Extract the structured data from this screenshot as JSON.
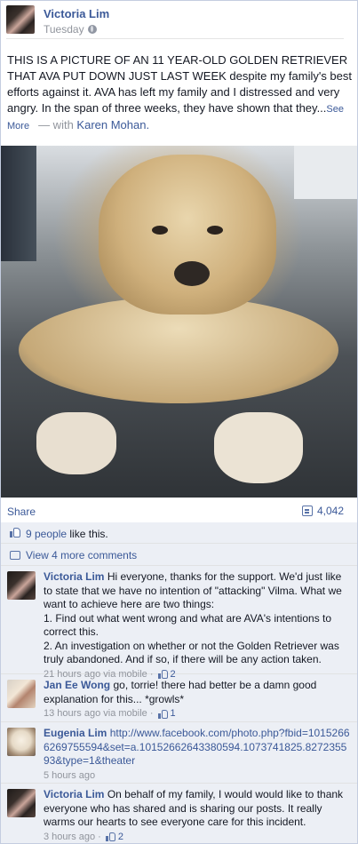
{
  "post": {
    "author": "Victoria Lim",
    "time": "Tuesday",
    "text": "THIS IS A PICTURE OF AN 11 YEAR-OLD GOLDEN RETRIEVER THAT AVA PUT DOWN JUST LAST WEEK despite my family's best efforts against it. AVA has left my family and I distressed and very angry. In the span of three weeks, they have shown that they...",
    "see_more": "See More",
    "with_prefix": "— with",
    "tagged": "Karen Mohan."
  },
  "actions": {
    "share_label": "Share",
    "share_count": "4,042"
  },
  "likes": {
    "people": "9 people",
    "suffix": "like this."
  },
  "view_more": "View 4 more comments",
  "comments": [
    {
      "name": "Victoria Lim",
      "text": "Hi everyone, thanks for the support. We'd just like to state that we have no intention of \"attacking\" Vilma. What we want to achieve here are two things:",
      "line1": "1. Find out what went wrong and what are AVA's intentions to correct this.",
      "line2": "2. An investigation on whether or not the Golden Retriever was truly abandoned. And if so, if there will be any action taken.",
      "meta": "21 hours ago via mobile ·",
      "likes": "2"
    },
    {
      "name": "Jan Ee Wong",
      "text": "go, torrie! there had better be a damn good explanation for this... *growls*",
      "meta": "13 hours ago via mobile ·",
      "likes": "1"
    },
    {
      "name": "Eugenia Lim",
      "link": "http://www.facebook.com/photo.php?fbid=10152666269755594&set=a.10152662643380594.1073741825.827235593&type=1&theater",
      "meta": "5 hours ago"
    },
    {
      "name": "Victoria Lim",
      "text": "On behalf of my family, I would would like to thank everyone who has shared and is sharing our posts. It really warms our hearts to see everyone care for this incident.",
      "meta": "3 hours ago ·",
      "likes": "2"
    }
  ]
}
